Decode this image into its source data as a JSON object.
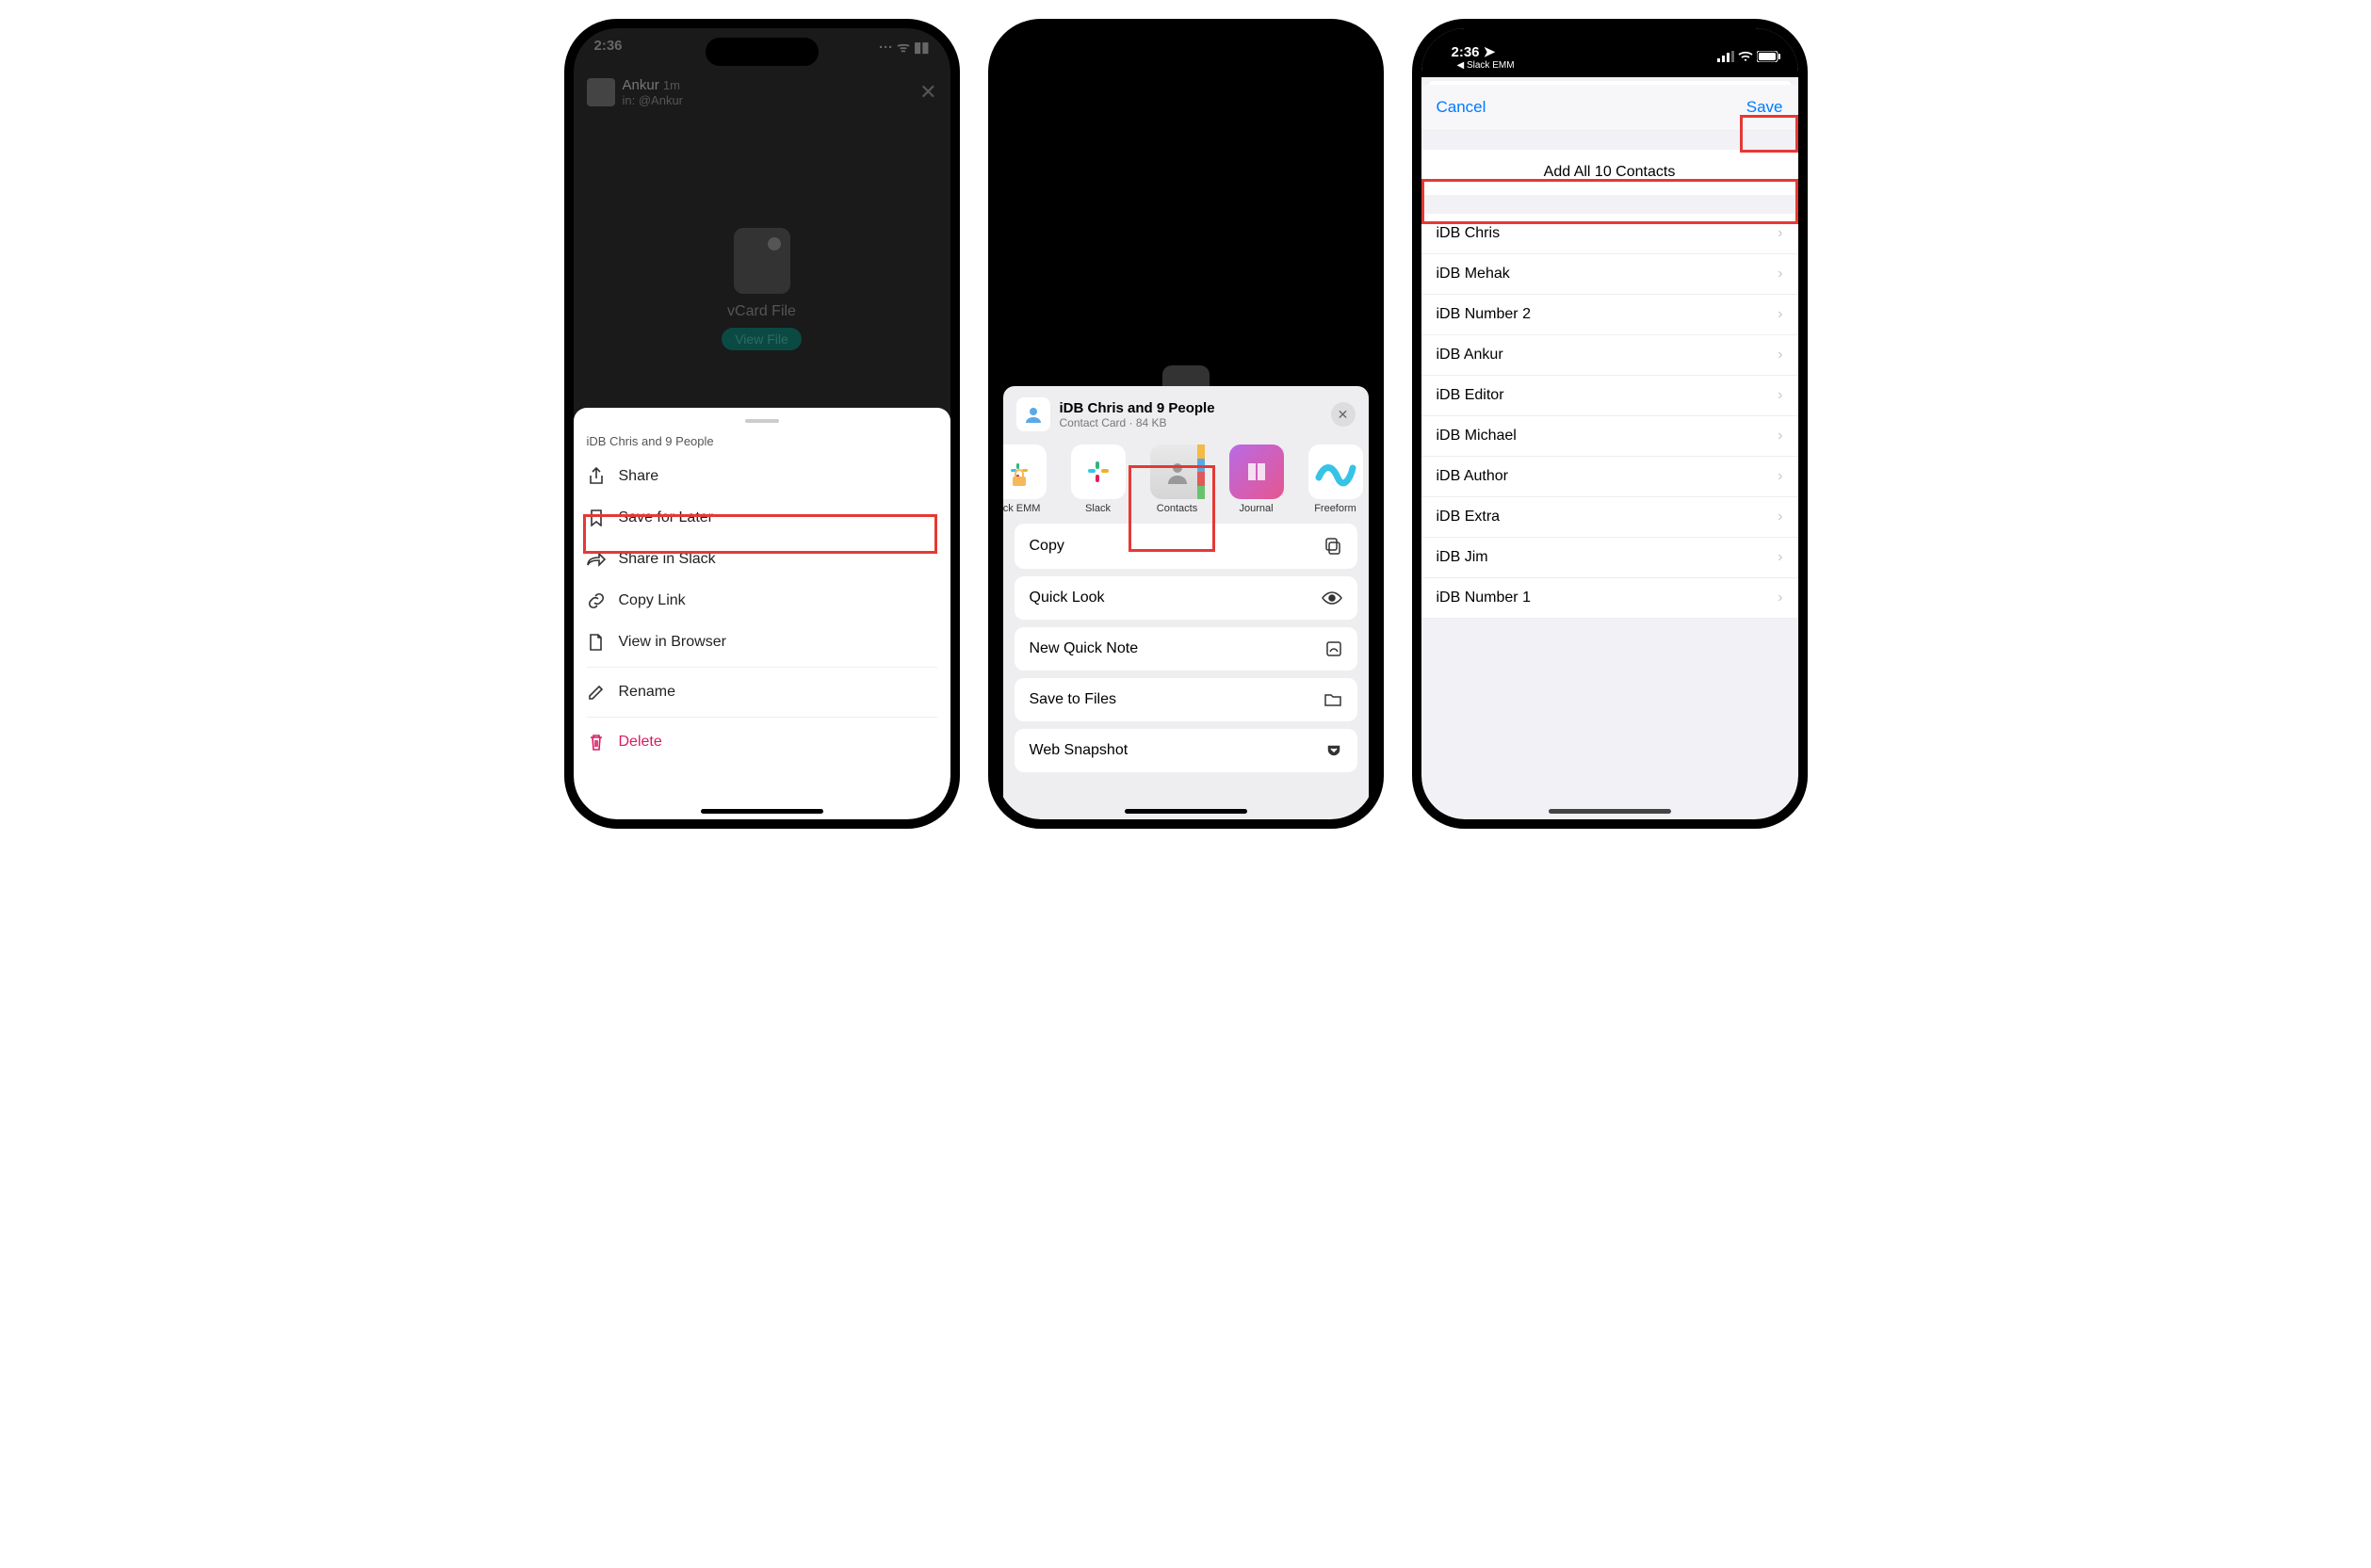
{
  "phone1": {
    "statusbar": {
      "time": "2:36",
      "indicators": "···  ᯤ  ▮▮"
    },
    "header": {
      "name": "Ankur",
      "time": "1m",
      "sub": "in: @Ankur"
    },
    "file": {
      "label": "vCard File",
      "view": "View File"
    },
    "sheet": {
      "title": "iDB Chris and 9 People",
      "share": "Share",
      "save_later": "Save for Later",
      "share_slack": "Share in Slack",
      "copy_link": "Copy Link",
      "view_browser": "View in Browser",
      "rename": "Rename",
      "delete": "Delete"
    }
  },
  "phone2": {
    "header": {
      "title": "iDB Chris and 9 People",
      "sub": "Contact Card · 84 KB"
    },
    "apps": {
      "slack_emm": "ack EMM",
      "slack": "Slack",
      "contacts": "Contacts",
      "journal": "Journal",
      "freeform": "Freeform"
    },
    "actions": {
      "copy": "Copy",
      "quick_look": "Quick Look",
      "new_note": "New Quick Note",
      "save_files": "Save to Files",
      "web_snapshot": "Web Snapshot"
    }
  },
  "phone3": {
    "statusbar": {
      "time": "2:36",
      "back_app": "◀ Slack EMM"
    },
    "nav": {
      "cancel": "Cancel",
      "save": "Save"
    },
    "addall": "Add All 10 Contacts",
    "contacts": [
      "iDB Chris",
      "iDB Mehak",
      "iDB Number 2",
      "iDB Ankur",
      "iDB Editor",
      "iDB Michael",
      "iDB Author",
      "iDB Extra",
      "iDB Jim",
      "iDB Number 1"
    ]
  }
}
